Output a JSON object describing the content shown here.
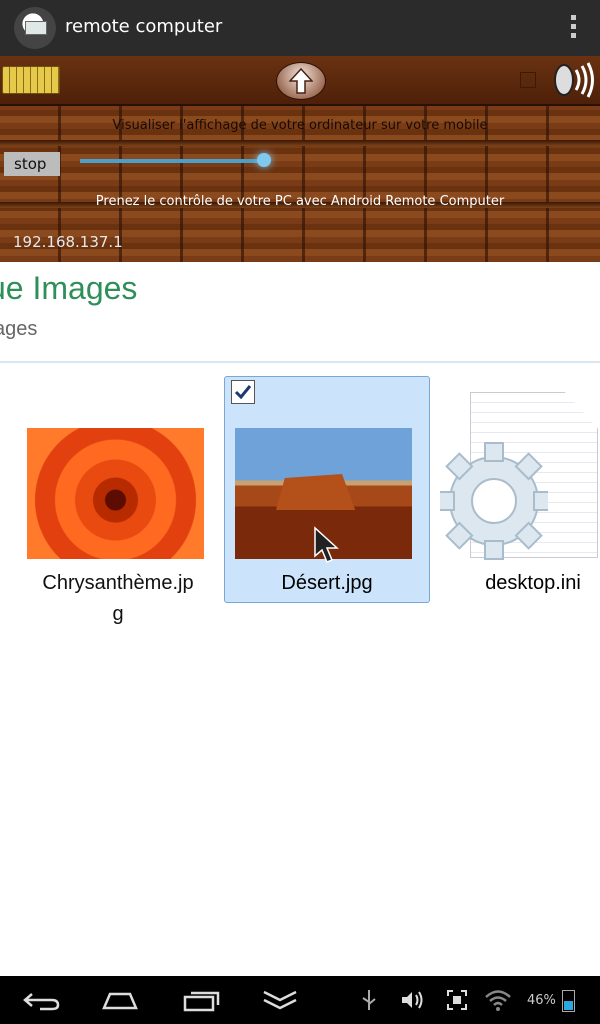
{
  "app": {
    "title": "remote computer"
  },
  "panel": {
    "caption_top": "Visualiser l'affichage de votre ordinateur sur votre mobile",
    "stop_label": "stop",
    "caption_bottom": "Prenez le contrôle de votre PC avec Android Remote Computer",
    "ip_address": "192.168.137.1",
    "slider_level": 0.95
  },
  "explorer": {
    "title": "ue Images",
    "subtitle": "ages",
    "files": [
      {
        "name": "Chrysanthème.jp g",
        "name_line1": "Chrysanthème.jp",
        "name_line2": "g",
        "selected": false
      },
      {
        "name": "Désert.jpg",
        "selected": true
      },
      {
        "name": "desktop.ini",
        "selected": false
      }
    ]
  },
  "status": {
    "battery": "46%"
  },
  "colors": {
    "accent_green": "#2f8f5a",
    "selection": "#cce4fb",
    "wood": "#7a3c16"
  }
}
